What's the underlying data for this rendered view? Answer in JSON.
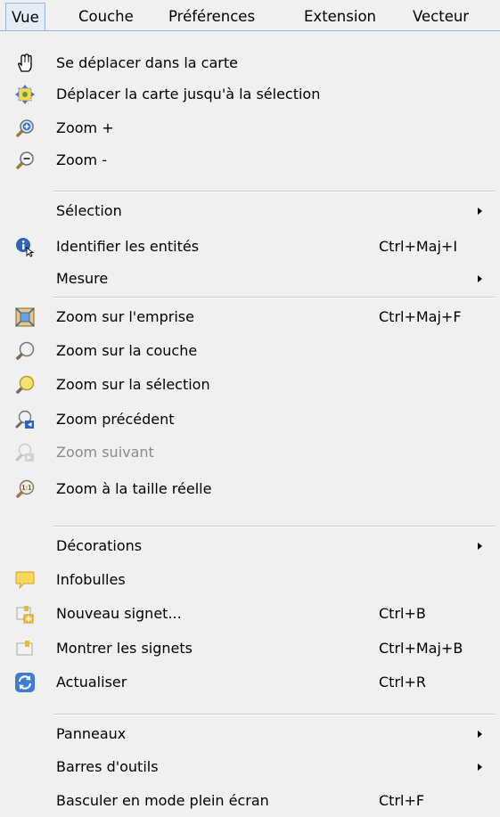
{
  "menubar": {
    "items": [
      "Vue",
      "Couche",
      "Préférences",
      "Extension",
      "Vecteur"
    ]
  },
  "menu": {
    "items": [
      {
        "label": "Se déplacer dans la carte",
        "icon": "pan-hand-icon"
      },
      {
        "label": "Déplacer la carte jusqu'à la sélection",
        "icon": "pan-to-selection-icon"
      },
      {
        "label": "Zoom +",
        "icon": "zoom-in-icon"
      },
      {
        "label": "Zoom -",
        "icon": "zoom-out-icon"
      },
      {
        "label": "Sélection",
        "submenu": true
      },
      {
        "label": "Identifier les entités",
        "shortcut": "Ctrl+Maj+I",
        "icon": "identify-icon"
      },
      {
        "label": "Mesure",
        "submenu": true
      },
      {
        "label": "Zoom sur l'emprise",
        "shortcut": "Ctrl+Maj+F",
        "icon": "zoom-full-extent-icon"
      },
      {
        "label": "Zoom sur la couche",
        "icon": "zoom-to-layer-icon"
      },
      {
        "label": "Zoom sur la sélection",
        "icon": "zoom-to-selection-icon"
      },
      {
        "label": "Zoom précédent",
        "icon": "zoom-last-icon"
      },
      {
        "label": "Zoom suivant",
        "icon": "zoom-next-icon",
        "disabled": true
      },
      {
        "label": "Zoom à la taille réelle",
        "icon": "zoom-actual-size-icon"
      },
      {
        "label": "Décorations",
        "submenu": true
      },
      {
        "label": "Infobulles",
        "icon": "map-tips-icon"
      },
      {
        "label": "Nouveau signet...",
        "shortcut": "Ctrl+B",
        "icon": "new-bookmark-icon"
      },
      {
        "label": "Montrer les signets",
        "shortcut": "Ctrl+Maj+B",
        "icon": "show-bookmarks-icon"
      },
      {
        "label": "Actualiser",
        "shortcut": "Ctrl+R",
        "icon": "refresh-icon"
      },
      {
        "label": "Panneaux",
        "submenu": true
      },
      {
        "label": "Barres d'outils",
        "submenu": true
      },
      {
        "label": "Basculer en mode plein écran",
        "shortcut": "Ctrl+F"
      }
    ]
  }
}
